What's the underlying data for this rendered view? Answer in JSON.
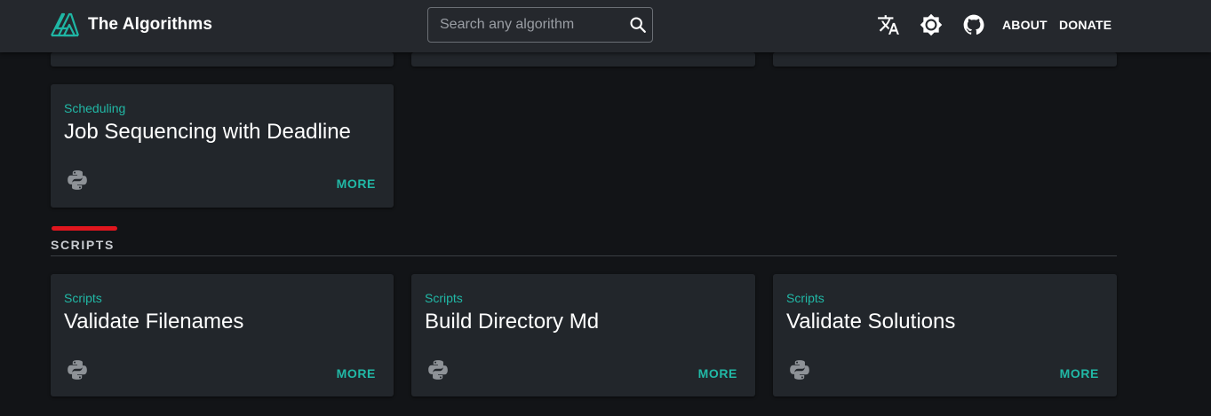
{
  "header": {
    "brand_title": "The Algorithms",
    "search_placeholder": "Search any algorithm",
    "about_label": "ABOUT",
    "donate_label": "DONATE",
    "icons": [
      "translate-icon",
      "theme-brightness-icon",
      "github-icon",
      "search-icon"
    ]
  },
  "colors": {
    "accent": "#21b8a6",
    "section_accent": "#e0161e",
    "card_bg": "#22262b",
    "page_bg": "#121417",
    "header_bg": "#25282d"
  },
  "scheduling_card": {
    "category": "Scheduling",
    "name": "Job Sequencing with Deadline",
    "more_label": "MORE",
    "language_icon": "python-icon"
  },
  "scripts_section": {
    "title": "SCRIPTS",
    "cards": [
      {
        "category": "Scripts",
        "name": "Validate Filenames",
        "more_label": "MORE",
        "language_icon": "python-icon"
      },
      {
        "category": "Scripts",
        "name": "Build Directory Md",
        "more_label": "MORE",
        "language_icon": "python-icon"
      },
      {
        "category": "Scripts",
        "name": "Validate Solutions",
        "more_label": "MORE",
        "language_icon": "python-icon"
      }
    ]
  }
}
